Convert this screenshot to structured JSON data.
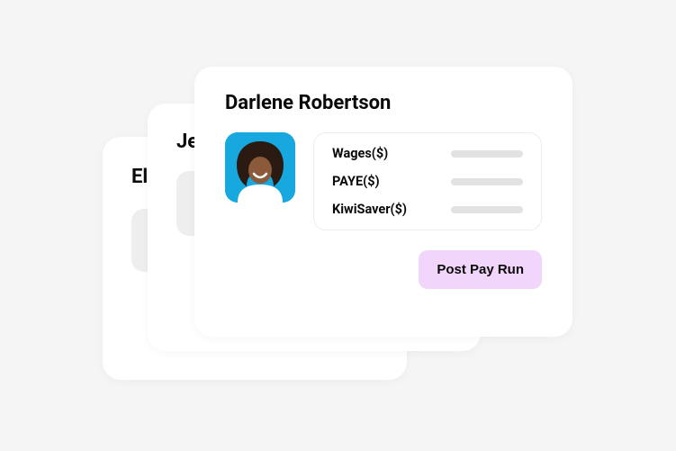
{
  "cards": {
    "back": {
      "name_fragment": "Eli"
    },
    "mid": {
      "name_fragment": "Je"
    },
    "front": {
      "name": "Darlene Robertson",
      "fields": [
        {
          "label": "Wages($)"
        },
        {
          "label": "PAYE($)"
        },
        {
          "label": "KiwiSaver($)"
        }
      ],
      "button_label": "Post Pay Run"
    }
  },
  "colors": {
    "button_bg": "#f2d5fb",
    "avatar_bg": "#18a8e0"
  }
}
